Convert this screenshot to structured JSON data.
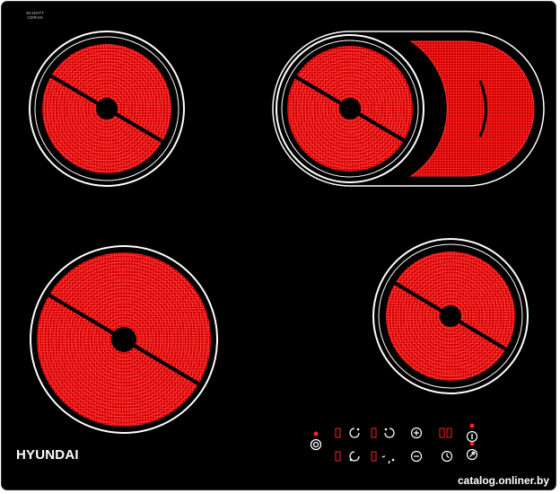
{
  "brand": "HYUNDAI",
  "glass_maker": {
    "line1": "SCHOTT",
    "line2": "CERAN"
  },
  "watermark": "catalog.onliner.by",
  "colors": {
    "glass": "#000000",
    "zone_fill": "#e00000",
    "zone_coil": "#ff4a4a",
    "ring": "#ffffff",
    "indicator": "#ff2020"
  },
  "cooking_zones": [
    {
      "name": "rear-left-zone",
      "type": "single"
    },
    {
      "name": "rear-right-zone",
      "type": "dual-with-extension"
    },
    {
      "name": "front-left-zone",
      "type": "single"
    },
    {
      "name": "front-right-zone",
      "type": "single"
    }
  ],
  "controls": [
    {
      "name": "power-button",
      "icon": "power-icon"
    },
    {
      "name": "zone-select-1",
      "icon": "zone-icon"
    },
    {
      "name": "zone-select-2",
      "icon": "zone-icon"
    },
    {
      "name": "zone-select-3",
      "icon": "zone-icon"
    },
    {
      "name": "zone-select-4",
      "icon": "zone-icon"
    },
    {
      "name": "plus-button",
      "icon": "plus-icon"
    },
    {
      "name": "minus-button",
      "icon": "minus-icon"
    },
    {
      "name": "timer-button",
      "icon": "clock-icon"
    },
    {
      "name": "lock-button",
      "icon": "lock-icon"
    },
    {
      "name": "extension-button",
      "icon": "extension-icon"
    }
  ]
}
